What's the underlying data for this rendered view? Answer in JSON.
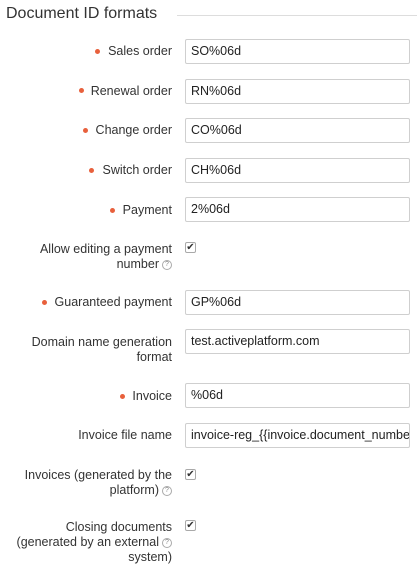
{
  "section": {
    "title": "Document ID formats"
  },
  "fields": {
    "sales_order": {
      "label": "Sales order",
      "value": "SO%06d"
    },
    "renewal_order": {
      "label": "Renewal order",
      "value": "RN%06d"
    },
    "change_order": {
      "label": "Change order",
      "value": "CO%06d"
    },
    "switch_order": {
      "label": "Switch order",
      "value": "CH%06d"
    },
    "payment": {
      "label": "Payment",
      "value": "2%06d"
    },
    "allow_editing": {
      "label_line1": "Allow editing a payment",
      "label_line2": "number",
      "checked": true
    },
    "guaranteed_payment": {
      "label": "Guaranteed payment",
      "value": "GP%06d"
    },
    "domain_name": {
      "label_line1": "Domain name generation",
      "label_line2": "format",
      "value": "test.activeplatform.com"
    },
    "invoice": {
      "label": "Invoice",
      "value": "%06d"
    },
    "invoice_file_name": {
      "label": "Invoice file name",
      "value": "invoice-reg_{{invoice.document_number}}"
    },
    "invoices_generated": {
      "label_line1": "Invoices (generated by the",
      "label_line2": "platform)",
      "checked": true
    },
    "closing_documents": {
      "label_line1": "Closing documents",
      "label_line2": "(generated by an external",
      "label_line3": "system)",
      "checked": true
    }
  },
  "icons": {
    "required": "required-dot-icon",
    "help": "help-icon",
    "check": "checkmark-icon"
  },
  "colors": {
    "required": "#e8603c",
    "border": "#cfcfcf",
    "text": "#333333"
  },
  "glyphs": {
    "help": "?",
    "check": "✔"
  }
}
